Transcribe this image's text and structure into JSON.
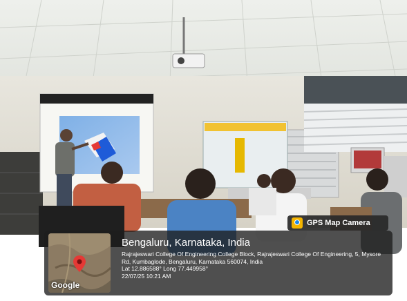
{
  "gps_badge": {
    "label": "GPS Map Camera",
    "icon": "gps-map-camera-icon"
  },
  "map": {
    "attribution": "Google",
    "marker_color": "#e53935"
  },
  "location": {
    "city": "Bengaluru, Karnataka, India",
    "address": "Rajrajeswari College Of Engineering College Block, Rajrajeswari College Of Engineering, 5, Mysore Rd, Kumbaglode, Bengaluru, Karnataka 560074, India",
    "coordinates": "Lat 12.886588° Long 77.449958°",
    "timestamp": "22/07/25 10:21 AM"
  }
}
